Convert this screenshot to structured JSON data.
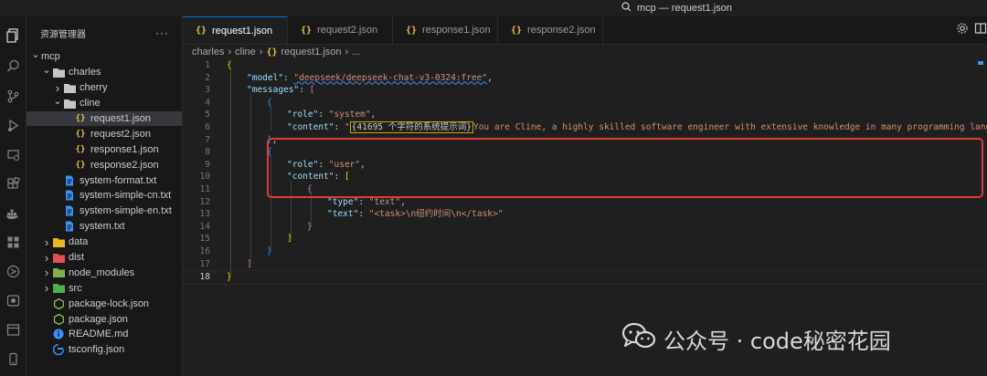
{
  "window": {
    "title": "mcp — request1.json"
  },
  "sidebar": {
    "title": "资源管理器",
    "more": "···",
    "tree": [
      {
        "label": "mcp",
        "indent": 0,
        "chevron": "down",
        "icon": "none"
      },
      {
        "label": "charles",
        "indent": 1,
        "chevron": "down",
        "icon": "folder-open"
      },
      {
        "label": "cherry",
        "indent": 2,
        "chevron": "right",
        "icon": "folder"
      },
      {
        "label": "cline",
        "indent": 2,
        "chevron": "down",
        "icon": "folder-open"
      },
      {
        "label": "request1.json",
        "indent": 3,
        "chevron": "none",
        "icon": "json",
        "active": true
      },
      {
        "label": "request2.json",
        "indent": 3,
        "chevron": "none",
        "icon": "json"
      },
      {
        "label": "response1.json",
        "indent": 3,
        "chevron": "none",
        "icon": "json"
      },
      {
        "label": "response2.json",
        "indent": 3,
        "chevron": "none",
        "icon": "json"
      },
      {
        "label": "system-format.txt",
        "indent": 2,
        "chevron": "none",
        "icon": "txt"
      },
      {
        "label": "system-simple-cn.txt",
        "indent": 2,
        "chevron": "none",
        "icon": "txt"
      },
      {
        "label": "system-simple-en.txt",
        "indent": 2,
        "chevron": "none",
        "icon": "txt"
      },
      {
        "label": "system.txt",
        "indent": 2,
        "chevron": "none",
        "icon": "txt"
      },
      {
        "label": "data",
        "indent": 1,
        "chevron": "right",
        "icon": "folder-yellow"
      },
      {
        "label": "dist",
        "indent": 1,
        "chevron": "right",
        "icon": "folder-red"
      },
      {
        "label": "node_modules",
        "indent": 1,
        "chevron": "right",
        "icon": "folder-green"
      },
      {
        "label": "src",
        "indent": 1,
        "chevron": "right",
        "icon": "folder-src"
      },
      {
        "label": "package-lock.json",
        "indent": 1,
        "chevron": "none",
        "icon": "node"
      },
      {
        "label": "package.json",
        "indent": 1,
        "chevron": "none",
        "icon": "node"
      },
      {
        "label": "README.md",
        "indent": 1,
        "chevron": "none",
        "icon": "info"
      },
      {
        "label": "tsconfig.json",
        "indent": 1,
        "chevron": "none",
        "icon": "ts"
      }
    ]
  },
  "tabs": [
    {
      "label": "request1.json",
      "active": true
    },
    {
      "label": "request2.json",
      "active": false
    },
    {
      "label": "response1.json",
      "active": false
    },
    {
      "label": "response2.json",
      "active": false
    }
  ],
  "breadcrumb": {
    "part1": "charles",
    "part2": "cline",
    "file": "request1.json",
    "more": "..."
  },
  "code": {
    "line_numbers": [
      "1",
      "2",
      "3",
      "4",
      "5",
      "6",
      "7",
      "8",
      "9",
      "10",
      "11",
      "12",
      "13",
      "14",
      "15",
      "16",
      "17",
      "18"
    ],
    "model_key": "\"model\"",
    "model_value": "\"deepseek/deepseek-chat-v3-0324:free\"",
    "messages_key": "\"messages\"",
    "role_key": "\"role\"",
    "role_system": "\"system\"",
    "content_key": "\"content\"",
    "content_quote": "\"",
    "content_collapsed": "41695 个字符的系统提示词",
    "content_rest": "You are Cline, a highly skilled software engineer with extensive knowledge in many programming langu",
    "role_user": "\"user\"",
    "type_key": "\"type\"",
    "type_value": "\"text\"",
    "text_key": "\"text\"",
    "text_value": "\"<task>\\n纽约时间\\n</task>\""
  },
  "watermark": {
    "text": "公众号 · code秘密花园"
  }
}
